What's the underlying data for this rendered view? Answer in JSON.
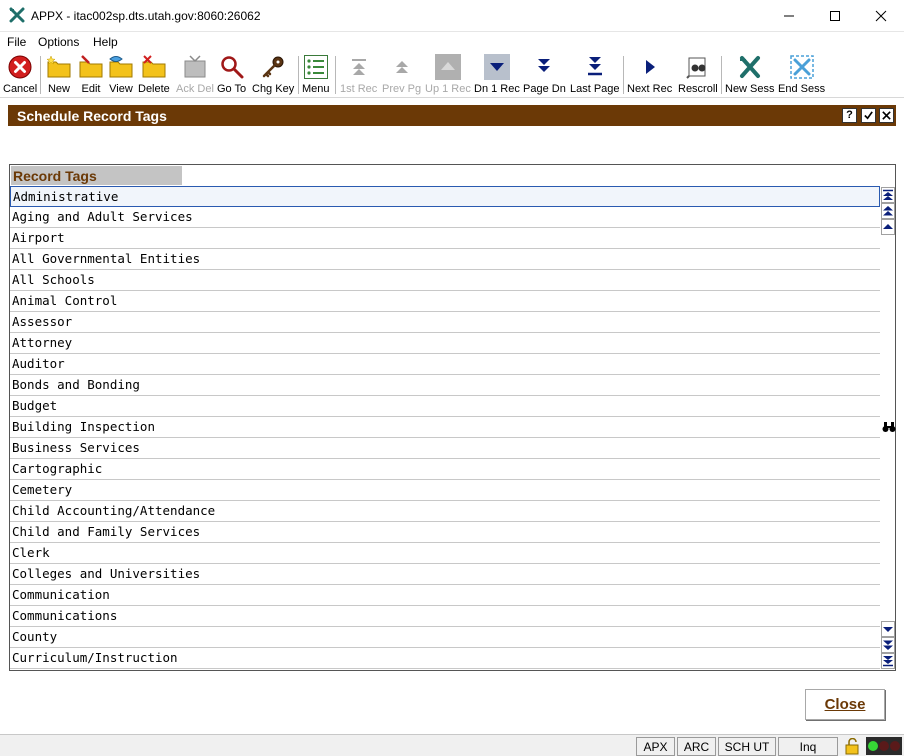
{
  "window": {
    "title": "APPX - itac002sp.dts.utah.gov:8060:26062"
  },
  "menu": [
    "File",
    "Options",
    "Help"
  ],
  "toolbar": {
    "cancel": "Cancel",
    "new": "New",
    "edit": "Edit",
    "view": "View",
    "delete": "Delete",
    "ack_del": "Ack Del",
    "go_to": "Go To",
    "chg_key": "Chg Key",
    "menu": "Menu",
    "first_rec": "1st Rec",
    "prev_pg": "Prev Pg",
    "up_1_rec": "Up 1 Rec",
    "dn_1_rec": "Dn 1 Rec",
    "page_dn": "Page Dn",
    "last_page": "Last Page",
    "next_rec": "Next Rec",
    "rescroll": "Rescroll",
    "new_sess": "New Sess",
    "end_sess": "End Sess"
  },
  "panel": {
    "title": "Schedule Record Tags",
    "help": "?"
  },
  "grid": {
    "header": "Record Tags",
    "rows": [
      "Administrative",
      "Aging and Adult Services",
      "Airport",
      "All Governmental Entities",
      "All Schools",
      "Animal Control",
      "Assessor",
      "Attorney",
      "Auditor",
      "Bonds and Bonding",
      "Budget",
      "Building Inspection",
      "Business Services",
      "Cartographic",
      "Cemetery",
      "Child Accounting/Attendance",
      "Child and Family Services",
      "Clerk",
      "Colleges and Universities",
      "Communication",
      "Communications",
      "County",
      "Curriculum/Instruction"
    ]
  },
  "close_button": "Close",
  "status": {
    "apx": "APX",
    "arc": "ARC",
    "sch": "SCH UT",
    "mode": "Inq"
  },
  "colors": {
    "accent": "#6b3906",
    "header_bg": "#c4c4c4"
  }
}
